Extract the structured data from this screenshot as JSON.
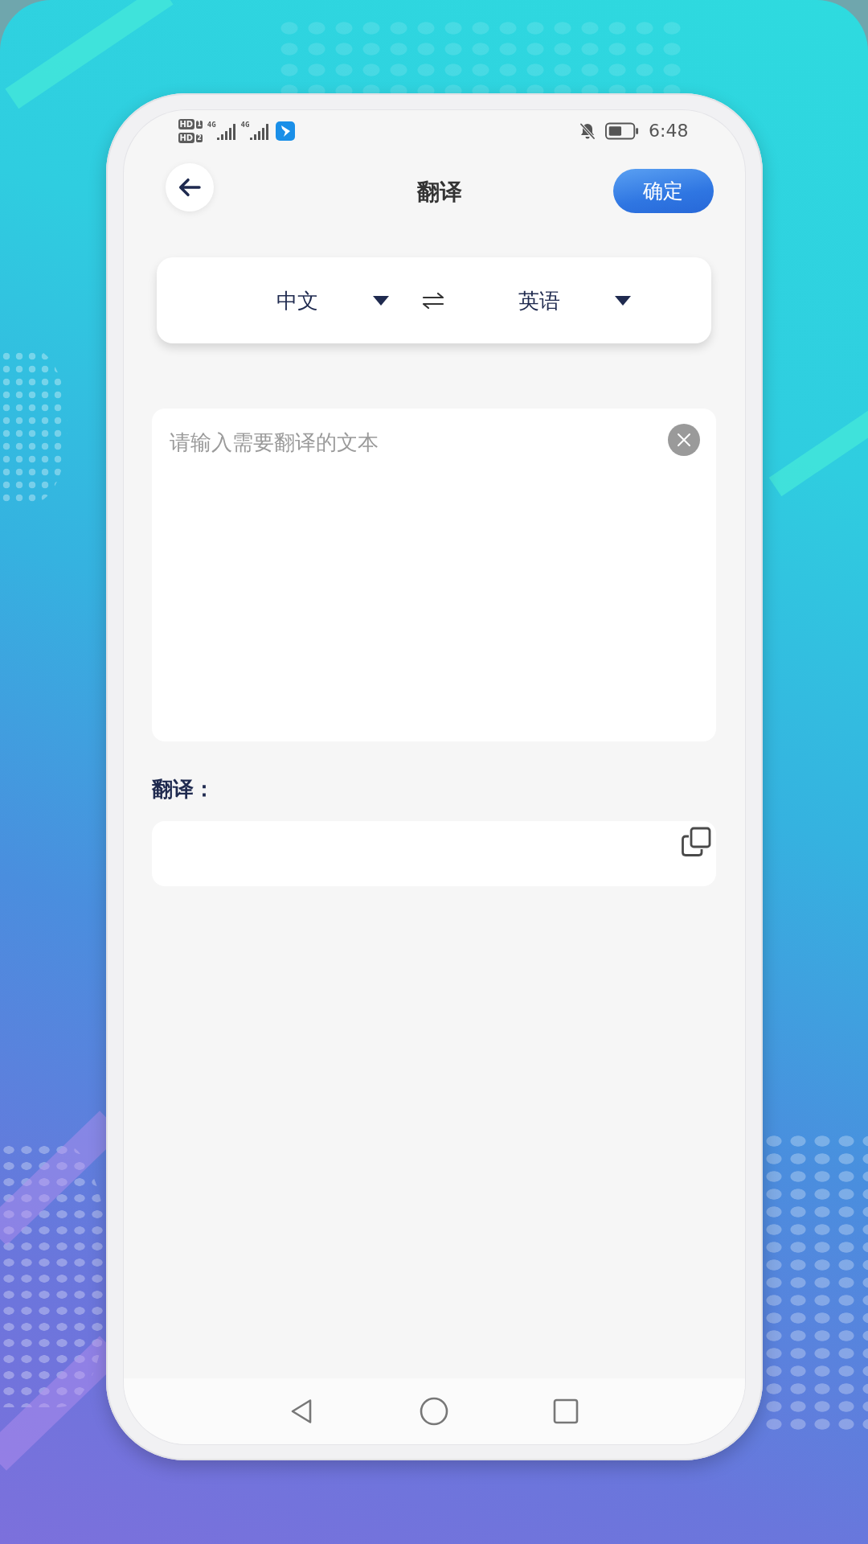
{
  "status_bar": {
    "sims": [
      {
        "badge": "HD",
        "slot": "1"
      },
      {
        "badge": "HD",
        "slot": "2"
      }
    ],
    "networks": [
      "4G",
      "4G"
    ],
    "time": "6:48"
  },
  "header": {
    "title": "翻译",
    "confirm_button": "确定"
  },
  "language_bar": {
    "source": "中文",
    "target": "英语"
  },
  "input": {
    "placeholder": "请输入需要翻译的文本"
  },
  "result": {
    "label": "翻译："
  }
}
